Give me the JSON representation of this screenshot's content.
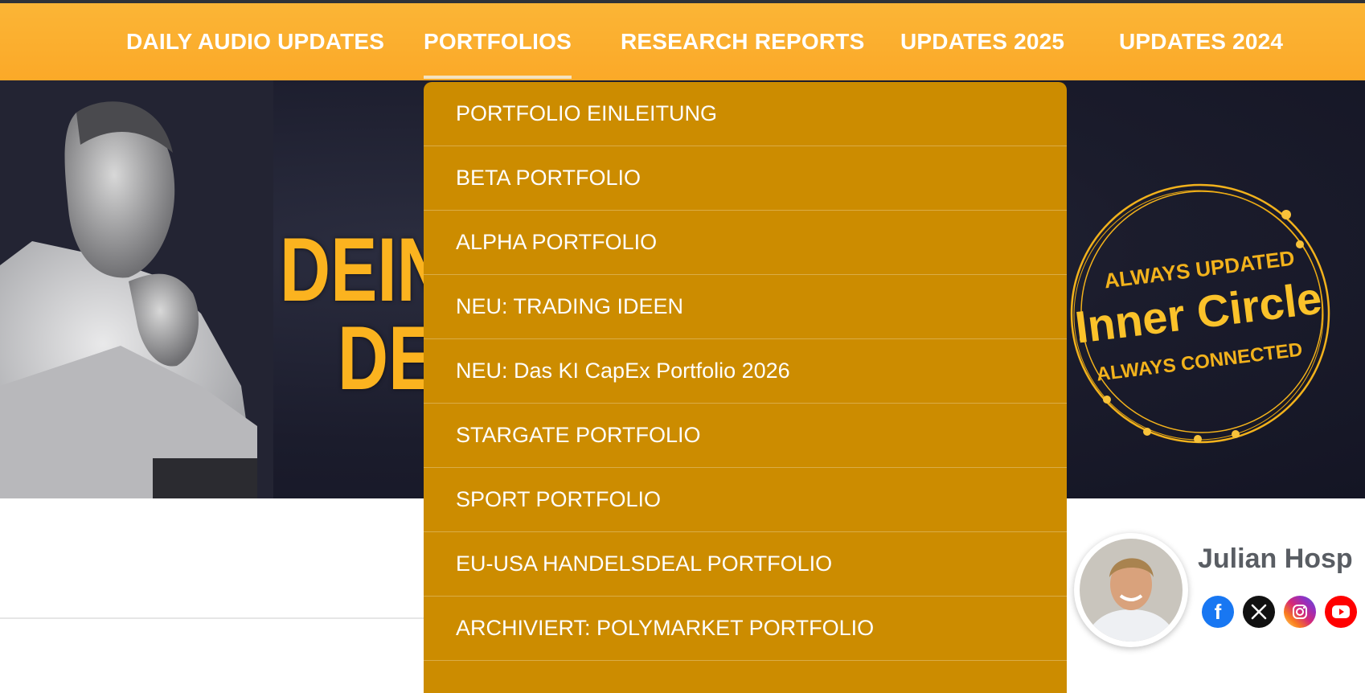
{
  "nav": {
    "items": [
      {
        "label": "DAILY AUDIO UPDATES"
      },
      {
        "label": "PORTFOLIOS"
      },
      {
        "label": "RESEARCH REPORTS"
      },
      {
        "label": "UPDATES 2025"
      },
      {
        "label": "UPDATES 2024"
      }
    ],
    "active_index": 1
  },
  "hero": {
    "heading_line1": "DEIN",
    "heading_line2": "DE",
    "badge": {
      "top": "ALWAYS UPDATED",
      "middle": "Inner Circle",
      "bottom": "ALWAYS CONNECTED"
    }
  },
  "dropdown": {
    "items": [
      "PORTFOLIO EINLEITUNG",
      "BETA PORTFOLIO",
      "ALPHA PORTFOLIO",
      "NEU: TRADING IDEEN",
      "NEU: Das KI CapEx Portfolio 2026",
      "STARGATE PORTFOLIO",
      "SPORT PORTFOLIO",
      "EU-USA HANDELSDEAL PORTFOLIO",
      "ARCHIVIERT: POLYMARKET PORTFOLIO"
    ]
  },
  "author": {
    "name": "Julian Hosp",
    "social": [
      {
        "icon": "facebook-icon",
        "glyph": "f",
        "color": "#1877f2"
      },
      {
        "icon": "x-icon",
        "glyph": "𝕏",
        "color": "#111111"
      },
      {
        "icon": "instagram-icon",
        "glyph": "",
        "color": "#d62976"
      },
      {
        "icon": "youtube-icon",
        "glyph": "▶",
        "color": "#ff0000"
      }
    ]
  },
  "colors": {
    "nav_bg": "#fbb030",
    "dropdown_bg": "#cc8c00",
    "hero_text": "#fbb31f",
    "hero_bg": "#1b1c2c"
  }
}
